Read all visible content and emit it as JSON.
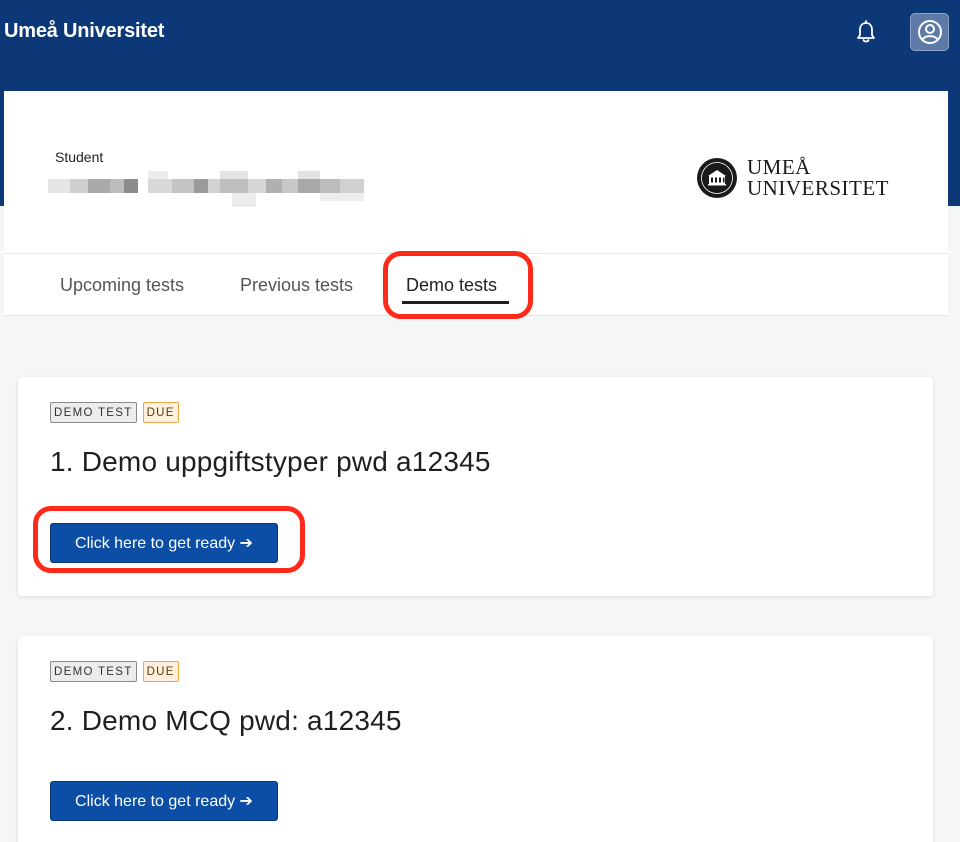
{
  "header": {
    "brand": "Umeå Universitet",
    "bell_icon": "bell-icon",
    "user_icon": "user-circle-icon"
  },
  "profile": {
    "role_label": "Student",
    "logo_line1": "UMEÅ",
    "logo_line2": "UNIVERSITET",
    "seal_text": "UMEÅ UNIVERSITET"
  },
  "tabs": [
    {
      "label": "Upcoming tests",
      "active": false
    },
    {
      "label": "Previous tests",
      "active": false
    },
    {
      "label": "Demo tests",
      "active": true
    }
  ],
  "tests": [
    {
      "type_badge": "DEMO TEST",
      "status_badge": "DUE",
      "title": "1. Demo uppgiftstyper pwd a12345",
      "button_label": "Click here to get ready ➔"
    },
    {
      "type_badge": "DEMO TEST",
      "status_badge": "DUE",
      "title": "2. Demo MCQ pwd: a12345",
      "button_label": "Click here to get ready ➔"
    }
  ],
  "colors": {
    "header_bg": "#0d3878",
    "button_bg": "#0c4ea6",
    "highlight": "#ff2a1a"
  }
}
